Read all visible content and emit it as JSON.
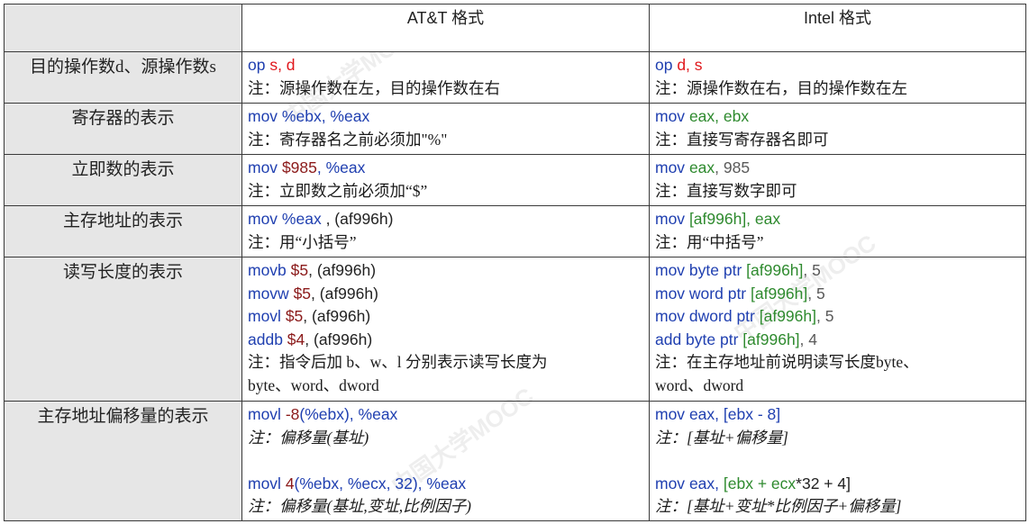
{
  "table": {
    "headers": [
      "AT&T 格式",
      "Intel 格式"
    ],
    "rows": [
      {
        "label": "目的操作数d、源操作数s",
        "att": [
          {
            "type": "code",
            "spans": [
              {
                "t": "op ",
                "c": "blue"
              },
              {
                "t": "s, d",
                "c": "red"
              }
            ]
          },
          {
            "type": "note",
            "text": "注：源操作数在左，目的操作数在右"
          }
        ],
        "intel": [
          {
            "type": "code",
            "spans": [
              {
                "t": "op ",
                "c": "blue"
              },
              {
                "t": "d, s",
                "c": "red"
              }
            ]
          },
          {
            "type": "note",
            "text": "注：源操作数在右，目的操作数在左"
          }
        ]
      },
      {
        "label": "寄存器的表示",
        "att": [
          {
            "type": "code",
            "spans": [
              {
                "t": "mov %ebx, %eax",
                "c": "blue"
              }
            ]
          },
          {
            "type": "note",
            "text": "注：寄存器名之前必须加\"%\""
          }
        ],
        "intel": [
          {
            "type": "code",
            "spans": [
              {
                "t": "mov ",
                "c": "blue"
              },
              {
                "t": "eax, ebx",
                "c": "green"
              }
            ]
          },
          {
            "type": "note",
            "text": "注：直接写寄存器名即可"
          }
        ]
      },
      {
        "label": "立即数的表示",
        "att": [
          {
            "type": "code",
            "spans": [
              {
                "t": "mov ",
                "c": "blue"
              },
              {
                "t": "$985",
                "c": "brown"
              },
              {
                "t": ", %eax",
                "c": "blue"
              }
            ]
          },
          {
            "type": "note",
            "text": "注：立即数之前必须加“$”"
          }
        ],
        "intel": [
          {
            "type": "code",
            "spans": [
              {
                "t": "mov ",
                "c": "blue"
              },
              {
                "t": "eax",
                "c": "green"
              },
              {
                "t": ", 985",
                "c": "gray"
              }
            ]
          },
          {
            "type": "note",
            "text": "注：直接写数字即可"
          }
        ]
      },
      {
        "label": "主存地址的表示",
        "att": [
          {
            "type": "code",
            "spans": [
              {
                "t": "mov %eax",
                "c": "blue"
              },
              {
                "t": " , (af996h)",
                "c": "dark"
              }
            ]
          },
          {
            "type": "note",
            "text": "注：用“小括号”"
          }
        ],
        "intel": [
          {
            "type": "code",
            "spans": [
              {
                "t": "mov ",
                "c": "blue"
              },
              {
                "t": "[af996h], eax",
                "c": "green"
              }
            ]
          },
          {
            "type": "note",
            "text": "注：用“中括号”"
          }
        ]
      },
      {
        "label": "读写长度的表示",
        "att": [
          {
            "type": "code",
            "spans": [
              {
                "t": "movb ",
                "c": "blue"
              },
              {
                "t": "$5",
                "c": "brown"
              },
              {
                "t": ", (af996h)",
                "c": "dark"
              }
            ]
          },
          {
            "type": "code",
            "spans": [
              {
                "t": "movw ",
                "c": "blue"
              },
              {
                "t": "$5",
                "c": "brown"
              },
              {
                "t": ", (af996h)",
                "c": "dark"
              }
            ]
          },
          {
            "type": "code",
            "spans": [
              {
                "t": "movl ",
                "c": "blue"
              },
              {
                "t": "$5",
                "c": "brown"
              },
              {
                "t": ", (af996h)",
                "c": "dark"
              }
            ]
          },
          {
            "type": "code",
            "spans": [
              {
                "t": "addb ",
                "c": "blue"
              },
              {
                "t": "$4",
                "c": "brown"
              },
              {
                "t": ", (af996h)",
                "c": "dark"
              }
            ]
          },
          {
            "type": "note",
            "text": "注：指令后加 b、w、l 分别表示读写长度为"
          },
          {
            "type": "note",
            "text": "byte、word、dword"
          }
        ],
        "intel": [
          {
            "type": "code",
            "spans": [
              {
                "t": "mov byte ptr ",
                "c": "blue"
              },
              {
                "t": "[af996h]",
                "c": "green"
              },
              {
                "t": ", 5",
                "c": "gray"
              }
            ]
          },
          {
            "type": "code",
            "spans": [
              {
                "t": "mov word ptr ",
                "c": "blue"
              },
              {
                "t": "[af996h]",
                "c": "green"
              },
              {
                "t": ", 5",
                "c": "gray"
              }
            ]
          },
          {
            "type": "code",
            "spans": [
              {
                "t": "mov dword ptr ",
                "c": "blue"
              },
              {
                "t": "[af996h]",
                "c": "green"
              },
              {
                "t": ", 5",
                "c": "gray"
              }
            ]
          },
          {
            "type": "code",
            "spans": [
              {
                "t": "add byte ptr ",
                "c": "blue"
              },
              {
                "t": "[af996h]",
                "c": "green"
              },
              {
                "t": ", 4",
                "c": "gray"
              }
            ]
          },
          {
            "type": "note",
            "text": "注：在主存地址前说明读写长度byte、"
          },
          {
            "type": "note",
            "text": "word、dword"
          }
        ]
      },
      {
        "label": "主存地址偏移量的表示",
        "att": [
          {
            "type": "code",
            "spans": [
              {
                "t": "movl ",
                "c": "blue"
              },
              {
                "t": "-8",
                "c": "brown"
              },
              {
                "t": "(%ebx), %eax",
                "c": "blue"
              }
            ]
          },
          {
            "type": "note_it",
            "text": "注：偏移量(基址)"
          },
          {
            "type": "gap"
          },
          {
            "type": "code",
            "spans": [
              {
                "t": "movl ",
                "c": "blue"
              },
              {
                "t": "4",
                "c": "brown"
              },
              {
                "t": "(%ebx, %ecx, 32), %eax",
                "c": "blue"
              }
            ]
          },
          {
            "type": "note_it",
            "text": "注：偏移量(基址,变址,比例因子)"
          }
        ],
        "intel": [
          {
            "type": "code",
            "spans": [
              {
                "t": "mov ",
                "c": "blue"
              },
              {
                "t": "eax, [ebx - 8]",
                "c": "blue"
              }
            ]
          },
          {
            "type": "note_it",
            "text": "注：[基址+偏移量]"
          },
          {
            "type": "gap"
          },
          {
            "type": "code",
            "spans": [
              {
                "t": "mov ",
                "c": "blue"
              },
              {
                "t": "eax, ",
                "c": "blue"
              },
              {
                "t": "[ebx + ecx",
                "c": "green"
              },
              {
                "t": "*32 + 4]",
                "c": "dark"
              }
            ]
          },
          {
            "type": "note_it",
            "text": "注：[基址+变址*比例因子+偏移量]"
          }
        ]
      }
    ]
  },
  "colors": {
    "code_blue": "#1f3fb0",
    "operand_red": "#e0161b",
    "register_green": "#2e8a2e",
    "immediate_brown": "#8b1a1a",
    "label_bg": "#e6e6e6"
  }
}
